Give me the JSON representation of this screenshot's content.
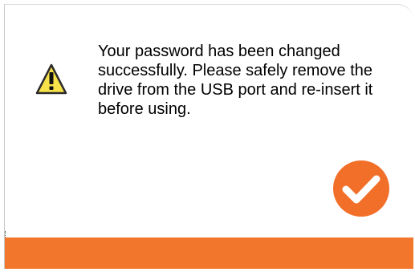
{
  "dialog": {
    "message": "Your password has been changed successfully. Please safely remove the drive from the USB port and re-insert it before using.",
    "icons": {
      "warning": "warning-icon",
      "confirm": "checkmark-icon"
    },
    "colors": {
      "accent": "#f2772c",
      "warning_fill": "#f8e24a",
      "check_fill": "#f26f2a"
    }
  }
}
